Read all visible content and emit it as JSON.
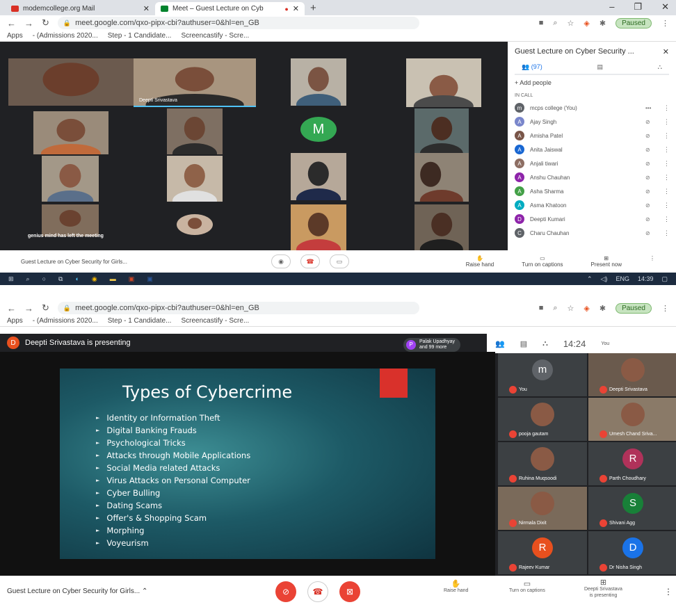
{
  "browser1": {
    "tabs": [
      {
        "title": "modemcollege.org Mail",
        "favicon_color": "#d93025"
      },
      {
        "title": "Meet – Guest Lecture on Cyb",
        "favicon_color": "#00832d"
      }
    ],
    "url": "meet.google.com/qxo-pipx-cbi?authuser=0&hl=en_GB",
    "paused": "Paused",
    "bookmarks": [
      "Apps",
      "- (Admissions 2020...",
      "Step - 1 Candidate...",
      "Screencastify - Scre..."
    ]
  },
  "meet1": {
    "tiles": [
      {
        "name": ""
      },
      {
        "name": "Deepti Srivastava"
      },
      {
        "name": ""
      },
      {
        "name": ""
      }
    ],
    "avatar_letter": "M",
    "left_message": "genius mind has left the meeting",
    "panel": {
      "title": "Guest Lecture on Cyber Security ...",
      "people_count": "(97)",
      "add_people": "Add people",
      "in_call": "IN CALL",
      "participants": [
        {
          "initial": "m",
          "name": "mcps college (You)",
          "color": "#5f6368"
        },
        {
          "initial": "A",
          "name": "Ajay Singh",
          "color": "#7986cb"
        },
        {
          "initial": "A",
          "name": "Amisha Patel",
          "color": "#795548"
        },
        {
          "initial": "A",
          "name": "Anita Jaiswal",
          "color": "#1967d2"
        },
        {
          "initial": "A",
          "name": "Anjali tiwari",
          "color": "#8d6e63"
        },
        {
          "initial": "A",
          "name": "Anshu Chauhan",
          "color": "#8e24aa"
        },
        {
          "initial": "A",
          "name": "Asha Sharma",
          "color": "#43a047"
        },
        {
          "initial": "A",
          "name": "Asma Khatoon",
          "color": "#00acc1"
        },
        {
          "initial": "D",
          "name": "Deepti Kumari",
          "color": "#8e24aa"
        },
        {
          "initial": "C",
          "name": "Charu Chauhan",
          "color": "#5f6368"
        }
      ]
    },
    "bottom": {
      "title": "Guest Lecture on Cyber Security for Girls...",
      "raise_hand": "Raise hand",
      "captions": "Turn on captions",
      "present": "Present now"
    },
    "taskbar": {
      "lang": "ENG",
      "time": "14:39"
    }
  },
  "browser2": {
    "url": "meet.google.com/qxo-pipx-cbi?authuser=0&hl=en_GB",
    "paused": "Paused",
    "bookmarks": [
      "Apps",
      "- (Admissions 2020...",
      "Step - 1 Candidate...",
      "Screencastify - Scre..."
    ]
  },
  "meet2": {
    "presenter_initial": "D",
    "presenting_text": "Deepti Srivastava is presenting",
    "palak_initial": "P",
    "palak_line1": "Palak Upadhyay",
    "palak_line2": "and 99 more",
    "clock": "14:24",
    "you_label": "You",
    "slide": {
      "title": "Types of Cybercrime",
      "bullets": [
        "Identity or Information Theft",
        "Digital Banking Frauds",
        "Psychological Tricks",
        "Attacks through Mobile Applications",
        "Social Media related Attacks",
        "Virus Attacks on Personal Computer",
        "Cyber Bulling",
        "Dating Scams",
        "Offer's & Shopping Scam",
        "Morphing",
        "Voyeurism"
      ]
    },
    "side_tiles": [
      {
        "name": "You",
        "initial": "m",
        "color": "#5f6368"
      },
      {
        "name": "Deepti Srivastava",
        "initial": "",
        "color": ""
      },
      {
        "name": "pooja gautam",
        "initial": "",
        "color": ""
      },
      {
        "name": "Umesh Chand Sriva...",
        "initial": "",
        "color": ""
      },
      {
        "name": "Ruhina Muqsoodi",
        "initial": "",
        "color": ""
      },
      {
        "name": "Parth Choudhary",
        "initial": "R",
        "color": "#b0325a"
      },
      {
        "name": "Nirmala Dixit",
        "initial": "",
        "color": ""
      },
      {
        "name": "Shivani Agg",
        "initial": "S",
        "color": "#188038"
      },
      {
        "name": "Rajeev Kumar",
        "initial": "R",
        "color": "#e8501e"
      },
      {
        "name": "Dr Nisha Singh",
        "initial": "D",
        "color": "#1a73e8"
      }
    ],
    "bottom": {
      "title": "Guest Lecture on Cyber Security for Girls...",
      "raise_hand": "Raise hand",
      "captions": "Turn on captions",
      "presenting_line1": "Deepti Srivastava",
      "presenting_line2": "is presenting"
    }
  }
}
